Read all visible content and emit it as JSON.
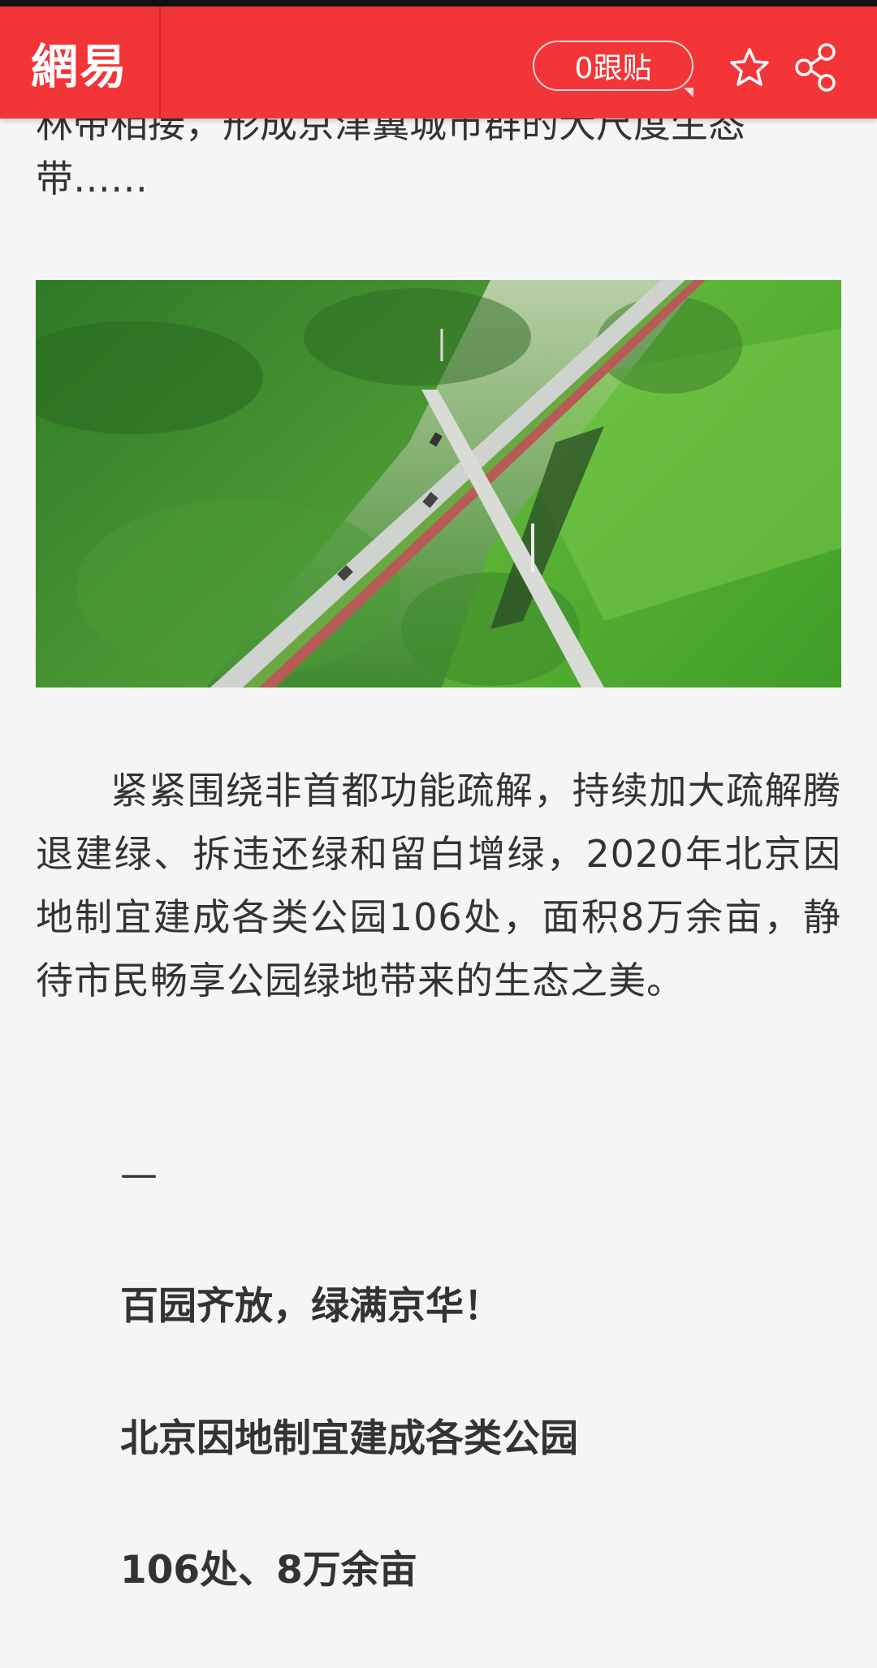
{
  "header": {
    "logo": "網易",
    "comments_label": "0跟贴",
    "favorite_icon": "star-outline-icon",
    "share_icon": "share-icon",
    "brand_color": "#f33537"
  },
  "article": {
    "clipped_line": "林带相接，形成京津冀城市群的大尺度生态",
    "para_tail": "带……",
    "photo_alt": "aerial-forest-road",
    "body": "紧紧围绕非首都功能疏解，持续加大疏解腾退建绿、拆违还绿和留白增绿，2020年北京因地制宜建成各类公园106处，面积8万余亩，静待市民畅享公园绿地带来的生态之美。",
    "dash": "—",
    "highlight1": "百园齐放，绿满京华！",
    "highlight2": "北京因地制宜建成各类公园",
    "highlight3": "106处、8万余亩"
  }
}
